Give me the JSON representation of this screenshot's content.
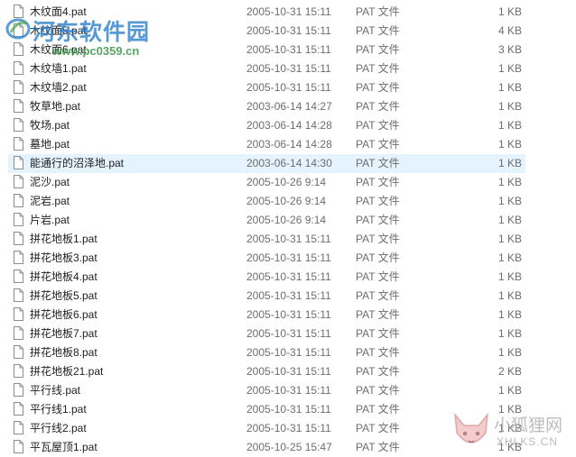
{
  "files": [
    {
      "name": "木纹面4.pat",
      "date": "2005-10-31 15:11",
      "type": "PAT 文件",
      "size": "1 KB"
    },
    {
      "name": "木纹面5.pat",
      "date": "2005-10-31 15:11",
      "type": "PAT 文件",
      "size": "4 KB"
    },
    {
      "name": "木纹面6.pat",
      "date": "2005-10-31 15:11",
      "type": "PAT 文件",
      "size": "3 KB"
    },
    {
      "name": "木纹墙1.pat",
      "date": "2005-10-31 15:11",
      "type": "PAT 文件",
      "size": "1 KB"
    },
    {
      "name": "木纹墙2.pat",
      "date": "2005-10-31 15:11",
      "type": "PAT 文件",
      "size": "1 KB"
    },
    {
      "name": "牧草地.pat",
      "date": "2003-06-14 14:27",
      "type": "PAT 文件",
      "size": "1 KB"
    },
    {
      "name": "牧场.pat",
      "date": "2003-06-14 14:28",
      "type": "PAT 文件",
      "size": "1 KB"
    },
    {
      "name": "墓地.pat",
      "date": "2003-06-14 14:28",
      "type": "PAT 文件",
      "size": "1 KB"
    },
    {
      "name": "能通行的沼泽地.pat",
      "date": "2003-06-14 14:30",
      "type": "PAT 文件",
      "size": "1 KB",
      "selected": true
    },
    {
      "name": "泥沙.pat",
      "date": "2005-10-26 9:14",
      "type": "PAT 文件",
      "size": "1 KB"
    },
    {
      "name": "泥岩.pat",
      "date": "2005-10-26 9:14",
      "type": "PAT 文件",
      "size": "1 KB"
    },
    {
      "name": "片岩.pat",
      "date": "2005-10-26 9:14",
      "type": "PAT 文件",
      "size": "1 KB"
    },
    {
      "name": "拼花地板1.pat",
      "date": "2005-10-31 15:11",
      "type": "PAT 文件",
      "size": "1 KB"
    },
    {
      "name": "拼花地板3.pat",
      "date": "2005-10-31 15:11",
      "type": "PAT 文件",
      "size": "1 KB"
    },
    {
      "name": "拼花地板4.pat",
      "date": "2005-10-31 15:11",
      "type": "PAT 文件",
      "size": "1 KB"
    },
    {
      "name": "拼花地板5.pat",
      "date": "2005-10-31 15:11",
      "type": "PAT 文件",
      "size": "1 KB"
    },
    {
      "name": "拼花地板6.pat",
      "date": "2005-10-31 15:11",
      "type": "PAT 文件",
      "size": "1 KB"
    },
    {
      "name": "拼花地板7.pat",
      "date": "2005-10-31 15:11",
      "type": "PAT 文件",
      "size": "1 KB"
    },
    {
      "name": "拼花地板8.pat",
      "date": "2005-10-31 15:11",
      "type": "PAT 文件",
      "size": "1 KB"
    },
    {
      "name": "拼花地板21.pat",
      "date": "2005-10-31 15:11",
      "type": "PAT 文件",
      "size": "2 KB"
    },
    {
      "name": "平行线.pat",
      "date": "2005-10-31 15:11",
      "type": "PAT 文件",
      "size": "1 KB"
    },
    {
      "name": "平行线1.pat",
      "date": "2005-10-31 15:11",
      "type": "PAT 文件",
      "size": "1 KB"
    },
    {
      "name": "平行线2.pat",
      "date": "2005-10-31 15:11",
      "type": "PAT 文件",
      "size": "1 KB"
    },
    {
      "name": "平瓦屋顶1.pat",
      "date": "2005-10-25 15:47",
      "type": "PAT 文件",
      "size": "1 KB"
    }
  ],
  "watermark_top": {
    "title": "河东软件园",
    "url": "www.pc0359.cn",
    "color": "#267cc8"
  },
  "watermark_bottom": {
    "title": "小狐狸网",
    "url": "XHLKS.CN"
  },
  "colors": {
    "selected_row": "#e5f3ff",
    "meta_text": "#6d6d6d",
    "name_text": "#1e1e1e"
  },
  "icons": {
    "file": "file-icon",
    "logo": "logo-icon",
    "fox": "fox-icon"
  }
}
